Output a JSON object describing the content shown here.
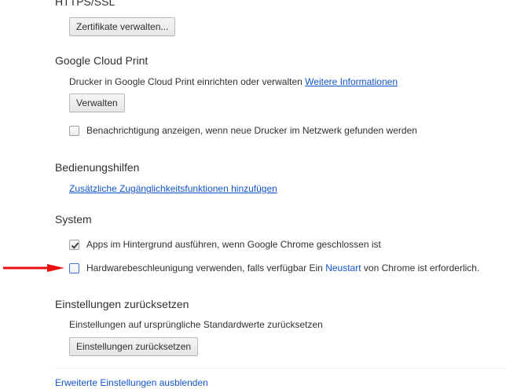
{
  "https_ssl": {
    "heading": "HTTPS/SSL",
    "manage_certs_button": "Zertifikate verwalten..."
  },
  "cloud_print": {
    "heading": "Google Cloud Print",
    "description": "Drucker in Google Cloud Print einrichten oder verwalten",
    "more_info_link": "Weitere Informationen",
    "manage_button": "Verwalten",
    "notify_checkbox_label": "Benachrichtigung anzeigen, wenn neue Drucker im Netzwerk gefunden werden",
    "notify_checked": false
  },
  "accessibility": {
    "heading": "Bedienungshilfen",
    "add_features_link": "Zusätzliche Zugänglichkeitsfunktionen hinzufügen"
  },
  "system": {
    "heading": "System",
    "background_apps_label": "Apps im Hintergrund ausführen, wenn Google Chrome geschlossen ist",
    "background_apps_checked": true,
    "hw_accel_label": "Hardwarebeschleunigung verwenden, falls verfügbar",
    "hw_accel_checked": false,
    "restart_notice_prefix": "Ein",
    "restart_link": "Neustart",
    "restart_notice_suffix": "von Chrome ist erforderlich."
  },
  "reset": {
    "heading": "Einstellungen zurücksetzen",
    "description": "Einstellungen auf ursprüngliche Standardwerte zurücksetzen",
    "reset_button": "Einstellungen zurücksetzen"
  },
  "footer": {
    "hide_advanced_link": "Erweiterte Einstellungen ausblenden"
  },
  "colors": {
    "link": "#1155cc",
    "annotation_arrow": "#e81010"
  }
}
